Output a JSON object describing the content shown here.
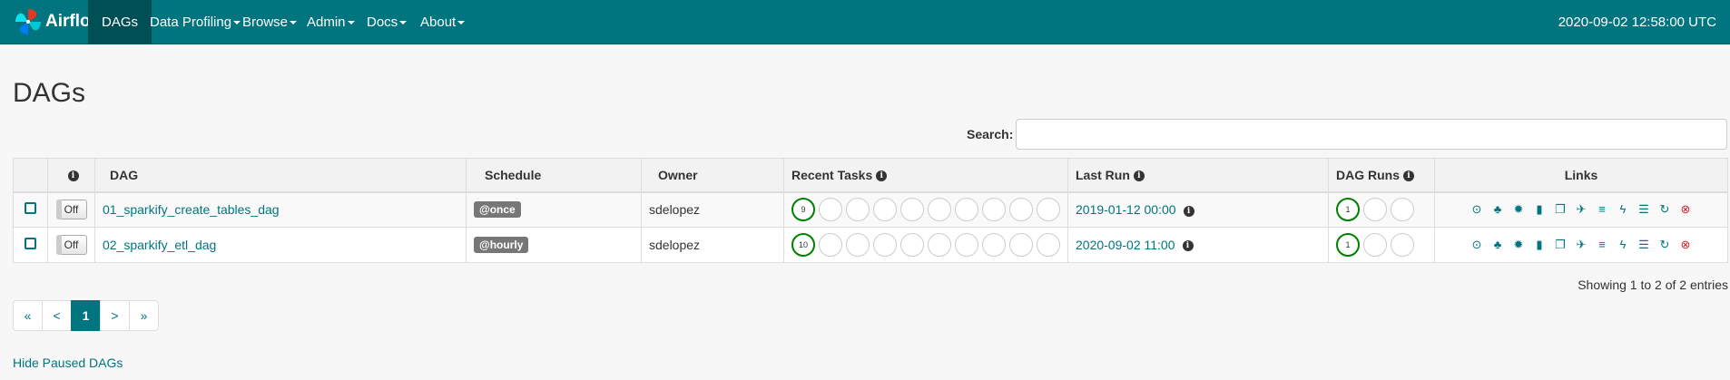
{
  "navbar": {
    "brand": "Airflow",
    "items": [
      {
        "label": "DAGs",
        "active": true,
        "caret": false
      },
      {
        "label": "Data Profiling",
        "caret": true
      },
      {
        "label": "Browse",
        "caret": true
      },
      {
        "label": "Admin",
        "caret": true
      },
      {
        "label": "Docs",
        "caret": true
      },
      {
        "label": "About",
        "caret": true
      }
    ],
    "time": "2020-09-02 12:58:00 UTC"
  },
  "page": {
    "title": "DAGs",
    "search_label": "Search:",
    "search_value": ""
  },
  "table": {
    "headers": {
      "info": "i",
      "dag": "DAG",
      "schedule": "Schedule",
      "owner": "Owner",
      "recent_tasks": "Recent Tasks",
      "last_run": "Last Run",
      "dag_runs": "DAG Runs",
      "links": "Links"
    },
    "rows": [
      {
        "toggle": "Off",
        "dag": "01_sparkify_create_tables_dag",
        "schedule": "@once",
        "owner": "sdelopez",
        "recent_task_success": "9",
        "last_run": "2019-01-12 00:00",
        "dag_run_success": "1"
      },
      {
        "toggle": "Off",
        "dag": "02_sparkify_etl_dag",
        "schedule": "@hourly",
        "owner": "sdelopez",
        "recent_task_success": "10",
        "last_run": "2020-09-02 11:00",
        "dag_run_success": "1"
      }
    ],
    "link_icons": [
      "play-circle-icon",
      "tree-icon",
      "graph-icon",
      "bar-chart-icon",
      "files-icon",
      "plane-icon",
      "gantt-icon",
      "flash-icon",
      "list-icon",
      "refresh-icon",
      "delete-icon"
    ]
  },
  "footer": {
    "entries": "Showing 1 to 2 of 2 entries",
    "pager": {
      "first": "«",
      "prev": "<",
      "current": "1",
      "next": ">",
      "last": "»"
    },
    "hide_paused": "Hide Paused DAGs"
  },
  "colors": {
    "accent": "#00757f",
    "success": "#008000",
    "danger": "#d9232e"
  }
}
